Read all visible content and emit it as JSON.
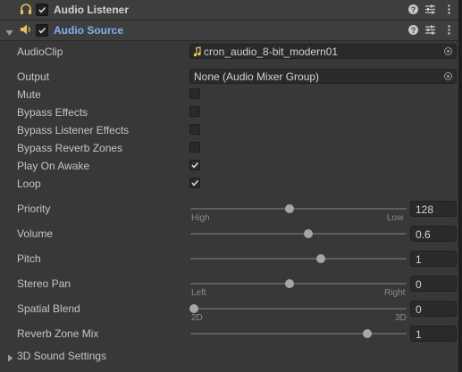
{
  "audio_listener": {
    "title": "Audio Listener",
    "enabled": true
  },
  "audio_source": {
    "title": "Audio Source",
    "enabled": true
  },
  "fields": {
    "audio_clip": {
      "label": "AudioClip",
      "value": "cron_audio_8-bit_modern01"
    },
    "output": {
      "label": "Output",
      "value": "None (Audio Mixer Group)"
    },
    "mute": {
      "label": "Mute",
      "checked": false
    },
    "bypass_effects": {
      "label": "Bypass Effects",
      "checked": false
    },
    "bypass_listener_effects": {
      "label": "Bypass Listener Effects",
      "checked": false
    },
    "bypass_reverb_zones": {
      "label": "Bypass Reverb Zones",
      "checked": false
    },
    "play_on_awake": {
      "label": "Play On Awake",
      "checked": true
    },
    "loop": {
      "label": "Loop",
      "checked": true
    }
  },
  "sliders": {
    "priority": {
      "label": "Priority",
      "value": "128",
      "fraction": 0.5,
      "left_caption": "High",
      "right_caption": "Low"
    },
    "volume": {
      "label": "Volume",
      "value": "0.6",
      "fraction": 0.6
    },
    "pitch": {
      "label": "Pitch",
      "value": "1",
      "fraction": 0.667
    },
    "stereo_pan": {
      "label": "Stereo Pan",
      "value": "0",
      "fraction": 0.5,
      "left_caption": "Left",
      "right_caption": "Right"
    },
    "spatial_blend": {
      "label": "Spatial Blend",
      "value": "0",
      "fraction": 0.0,
      "left_caption": "2D",
      "right_caption": "3D"
    },
    "reverb_zone_mix": {
      "label": "Reverb Zone Mix",
      "value": "1",
      "fraction": 0.909
    }
  },
  "sound_3d": {
    "label": "3D Sound Settings"
  },
  "colors": {
    "accent_title": "#7fb2ee",
    "audio_clip_icon": "#e8c45a"
  }
}
